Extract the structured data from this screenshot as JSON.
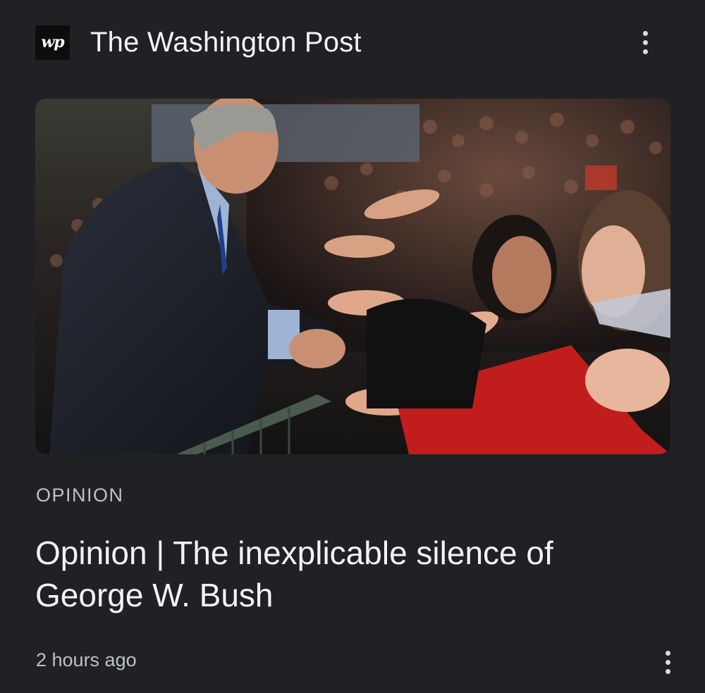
{
  "publisher": {
    "logo_text": "wp",
    "name": "The Washington Post"
  },
  "article": {
    "section": "OPINION",
    "headline": "Opinion | The inexplicable silence of George W. Bush",
    "timestamp": "2 hours ago",
    "image_alt": "Man in a dark suit shaking hands with a cheering crowd reaching over a barrier"
  },
  "menus": {
    "header_icon": "more-vert-icon",
    "footer_icon": "more-vert-icon"
  },
  "colors": {
    "background": "#202124",
    "primary_text": "#f1f3f4",
    "secondary_text": "#bdc1c6"
  }
}
